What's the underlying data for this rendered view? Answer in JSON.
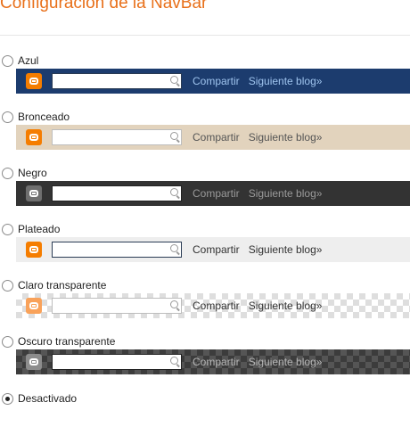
{
  "title": "Configuración de la NavBar",
  "compartir": "Compartir",
  "siguiente": "Siguiente blog»",
  "colors": {
    "title": "#e8701a",
    "azul": "#1c3c6e",
    "bronceado": "#e2d3bd",
    "negro": "#333333",
    "plateado": "#eeeeee",
    "blogger_orange": "#f57d00"
  },
  "options": [
    {
      "label": "Azul",
      "selected": false
    },
    {
      "label": "Bronceado",
      "selected": false
    },
    {
      "label": "Negro",
      "selected": false
    },
    {
      "label": "Plateado",
      "selected": false
    },
    {
      "label": "Claro transparente",
      "selected": false
    },
    {
      "label": "Oscuro transparente",
      "selected": false
    },
    {
      "label": "Desactivado",
      "selected": true
    }
  ]
}
